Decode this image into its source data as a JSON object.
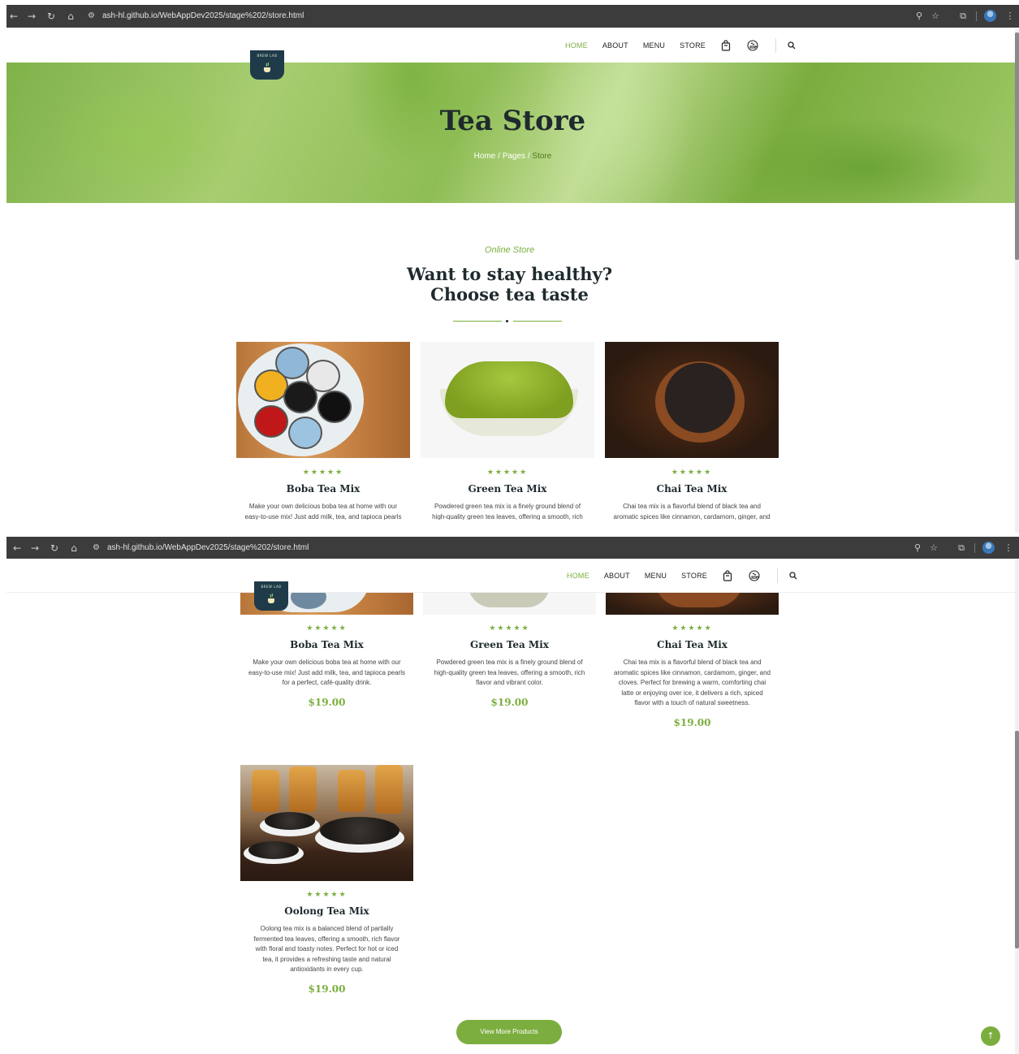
{
  "browser": {
    "url": "ash-hl.github.io/WebAppDev2025/stage%202/store.html"
  },
  "nav": {
    "items": [
      "HOME",
      "ABOUT",
      "MENU",
      "STORE"
    ],
    "active": "HOME"
  },
  "logo": {
    "text": "BREW LAB"
  },
  "hero": {
    "title": "Tea Store",
    "crumb_home": "Home",
    "crumb_sep1": " / ",
    "crumb_pages": "Pages",
    "crumb_sep2": " / ",
    "crumb_current": "Store"
  },
  "section": {
    "kicker": "Online Store",
    "heading_line1": "Want to stay healthy?",
    "heading_line2": "Choose tea taste"
  },
  "rating": "★★★★★",
  "products": [
    {
      "name": "Boba Tea Mix",
      "desc": "Make your own delicious boba tea at home with our easy-to-use mix! Just add milk, tea, and tapioca pearls for a perfect, café-quality drink.",
      "price": "$19.00"
    },
    {
      "name": "Green Tea Mix",
      "desc": "Powdered green tea mix is a finely ground blend of high-quality green tea leaves, offering a smooth, rich flavor and vibrant color.",
      "price": "$19.00"
    },
    {
      "name": "Chai Tea Mix",
      "desc": "Chai tea mix is a flavorful blend of black tea and aromatic spices like cinnamon, cardamom, ginger, and cloves. Perfect for brewing a warm, comforting chai latte or enjoying over ice, it delivers a rich, spiced flavor with a touch of natural sweetness.",
      "price": "$19.00"
    },
    {
      "name": "Oolong Tea Mix",
      "desc": "Oolong tea mix is a balanced blend of partially fermented tea leaves, offering a smooth, rich flavor with floral and toasty notes. Perfect for hot or iced tea, it provides a refreshing taste and natural antioxidants in every cup.",
      "price": "$19.00"
    }
  ],
  "view_more": "View More Products",
  "colors": {
    "accent": "#7cae3f",
    "dark": "#1f2a2e",
    "chrome": "#3c3c3c"
  },
  "icons": [
    "back-icon",
    "forward-icon",
    "reload-icon",
    "home-icon",
    "site-settings-icon",
    "zoom-icon",
    "bookmark-star-icon",
    "extensions-icon",
    "profile-avatar",
    "menu-dots-icon",
    "shopping-bag-icon",
    "tea-icon",
    "search-icon",
    "arrow-up-icon"
  ]
}
